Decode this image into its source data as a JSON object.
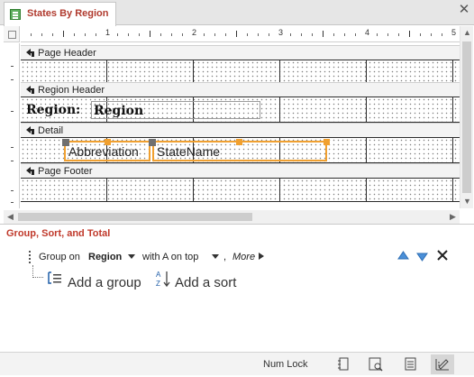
{
  "document_tab": {
    "title": "States By Region",
    "icon": "report-icon"
  },
  "ruler": {
    "numbers": [
      "1",
      "2",
      "3",
      "4",
      "5"
    ]
  },
  "sections": {
    "page_header": "Page Header",
    "region_header": "Region Header",
    "detail": "Detail",
    "page_footer": "Page Footer"
  },
  "controls": {
    "region_label": "Region:",
    "region_textbox": "Region",
    "abbreviation_textbox": "Abbreviation",
    "statename_textbox": "StateName"
  },
  "group_sort_total": {
    "title": "Group, Sort, and Total",
    "group_on_label": "Group on",
    "group_field": "Region",
    "sort_order": "with A on top",
    "separator": ",",
    "more_label": "More",
    "add_group_label": "Add a group",
    "add_sort_label": "Add a sort"
  },
  "status_bar": {
    "num_lock": "Num Lock",
    "views": [
      "report-view-icon",
      "print-preview-icon",
      "layout-view-icon",
      "design-view-icon"
    ],
    "active_view": "design-view-icon"
  },
  "colors": {
    "tab_title": "#b03a2e",
    "pane_title": "#c0392b",
    "selection": "#f0a030",
    "move_up": "#4a8fd8"
  }
}
